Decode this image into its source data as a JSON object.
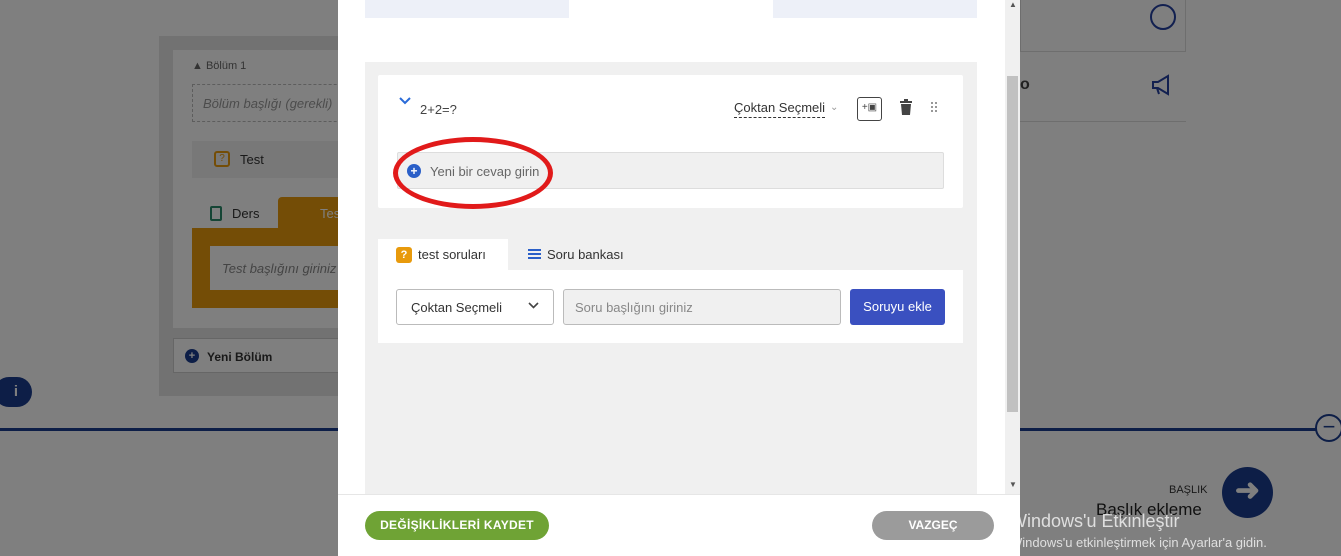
{
  "background": {
    "section_label": "▲ Bölüm 1",
    "section_title_placeholder": "Bölüm başlığı (gerekli)",
    "test_item": "Test",
    "tabs": {
      "ders": "Ders",
      "test": "Test"
    },
    "test_title_placeholder": "Test başlığını giriniz",
    "new_section": "Yeni Bölüm",
    "info": "i",
    "right_letter": "o",
    "timeline_small_label": "BAŞLIK",
    "timeline_big_label": "Başlık ekleme"
  },
  "modal": {
    "question": {
      "title": "2+2=?",
      "type": "Çoktan Seçmeli",
      "answer_placeholder": "Yeni bir cevap girin"
    },
    "tabs": [
      {
        "label": "test soruları",
        "icon": "question-bubble-icon",
        "active": true
      },
      {
        "label": "Soru bankası",
        "icon": "list-icon",
        "active": false
      }
    ],
    "add_question": {
      "type_selected": "Çoktan Seçmeli",
      "title_placeholder": "Soru başlığını giriniz",
      "add_button": "Soruyu ekle"
    },
    "footer": {
      "save": "DEĞİŞİKLİKLERİ KAYDET",
      "cancel": "VAZGEÇ"
    }
  },
  "windows_watermark": {
    "line1": "Windows'u Etkinleştir",
    "line2": "Windows'u etkinleştirmek için Ayarlar'a gidin."
  },
  "colors": {
    "accent_blue": "#1b3d8f",
    "orange": "#e89a0c",
    "save_green": "#6fa335",
    "add_button_blue": "#3a50c0",
    "highlight_red": "#e11a1a"
  }
}
